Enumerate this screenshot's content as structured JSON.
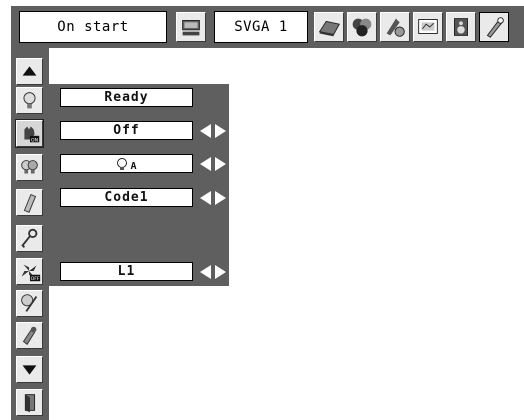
{
  "topbar": {
    "start_field": "On start",
    "source_field": "SVGA 1",
    "icons": [
      "computer-input-icon",
      "laptop-icon",
      "image-adjust-icon",
      "color-adjust-icon",
      "screen-icon",
      "speaker-icon",
      "setting-wrench-icon"
    ]
  },
  "sidebar": {
    "icons": [
      "scroll-up-icon",
      "lamp-icon",
      "power-on-icon",
      "lamp-mode-icon",
      "remote-control-icon",
      "security-key-icon",
      "fan-off-icon",
      "filter-icon",
      "maintenance-icon",
      "scroll-down-icon",
      "exit-icon"
    ]
  },
  "panel": {
    "lamp_status": "Ready",
    "direct_on": "Off",
    "lamp_mode_suffix": "A",
    "remote_control": "Code1",
    "fan_control": "L1"
  },
  "colors": {
    "frame": "#5f5f5f",
    "button_face": "#eaeaea"
  }
}
